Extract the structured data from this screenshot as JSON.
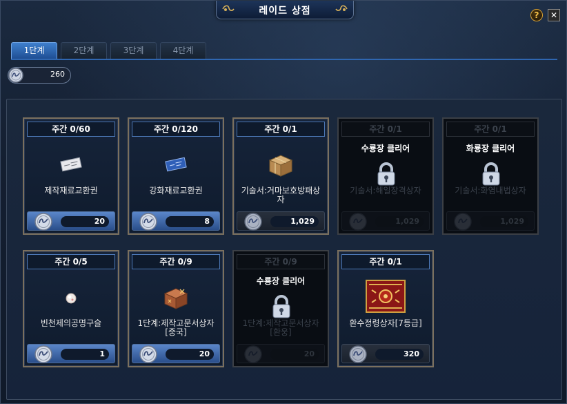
{
  "window": {
    "title": "레이드 상점",
    "help_glyph": "?",
    "close_glyph": "✕"
  },
  "tabs": [
    {
      "label": "1단계",
      "active": true
    },
    {
      "label": "2단계",
      "active": false
    },
    {
      "label": "3단계",
      "active": false
    },
    {
      "label": "4단계",
      "active": false
    }
  ],
  "balance": {
    "value": "260",
    "icon": "raid-coin-icon"
  },
  "lock_label": "수룡장 클리어",
  "items": [
    {
      "limit": "주간 0/60",
      "name": "제작재료교환권",
      "price": "20",
      "locked": false,
      "icon": "ticket-icon"
    },
    {
      "limit": "주간 0/120",
      "name": "강화재료교환권",
      "price": "8",
      "locked": false,
      "icon": "blue-ticket-icon"
    },
    {
      "limit": "주간 0/1",
      "name": "기술서:거마보호방패상자",
      "price": "1,029",
      "locked": false,
      "icon": "box-icon"
    },
    {
      "limit": "주간 0/1",
      "name": "기술서:해일장격상자",
      "price": "1,029",
      "locked": true,
      "lock_text": "수룡장 클리어",
      "icon": "box-icon"
    },
    {
      "limit": "주간 0/1",
      "name": "기술서:화염내법상자",
      "price": "1,029",
      "locked": true,
      "lock_text": "화룡장 클리어",
      "icon": "box-icon"
    },
    {
      "limit": "주간 0/5",
      "name": "빈천제의공명구슬",
      "price": "1",
      "locked": false,
      "icon": "orb-icon"
    },
    {
      "limit": "주간 0/9",
      "name": "1단계:제작고문서상자[중국]",
      "price": "20",
      "locked": false,
      "icon": "chest-icon"
    },
    {
      "limit": "주간 0/9",
      "name": "1단계:제작고문서상자[환웅]",
      "price": "20",
      "locked": true,
      "lock_text": "수룡장 클리어",
      "icon": "chest-icon"
    },
    {
      "limit": "주간 0/1",
      "name": "환수정령상자[7등급]",
      "price": "320",
      "locked": false,
      "icon": "spirit-box-icon"
    }
  ],
  "colors": {
    "tab_active": "#3f7fcd",
    "price_active": "#5a86c9",
    "card_border": "#7b705e"
  }
}
